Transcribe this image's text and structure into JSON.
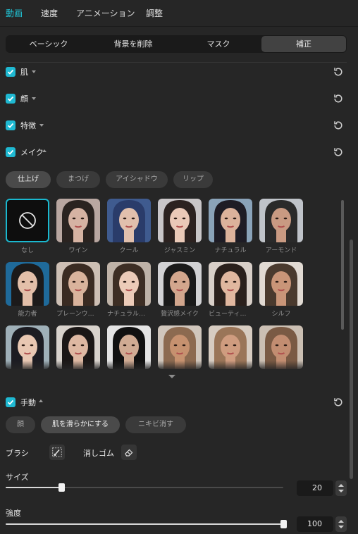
{
  "nav": {
    "tabs": [
      {
        "label": "動画",
        "active": true
      },
      {
        "label": "速度",
        "active": false
      },
      {
        "label": "アニメーション",
        "active": false
      },
      {
        "label": "調整",
        "active": false
      }
    ]
  },
  "segment": {
    "options": [
      "ベーシック",
      "背景を削除",
      "マスク",
      "補正"
    ],
    "active": "補正"
  },
  "sections": {
    "skin": {
      "label": "肌",
      "checked": true,
      "expanded": false
    },
    "face": {
      "label": "顔",
      "checked": true,
      "expanded": false
    },
    "features": {
      "label": "特徴",
      "checked": true,
      "expanded": false
    },
    "makeup": {
      "label": "メイク",
      "checked": true,
      "expanded": true
    },
    "manual": {
      "label": "手動",
      "checked": true,
      "expanded": true
    }
  },
  "makeup_tabs": [
    "仕上げ",
    "まつげ",
    "アイシャドウ",
    "リップ"
  ],
  "makeup_active_tab": "仕上げ",
  "makeup_presets": [
    "なし",
    "ワイン",
    "クール",
    "ジャスミン",
    "ナチュラル",
    "アーモンド",
    "能力者",
    "プレーンウォ…",
    "ナチュラルメ…",
    "贅沢感メイク",
    "ビューティー…",
    "シルフ"
  ],
  "selected_preset": "なし",
  "manual_tabs": [
    "顔",
    "肌を滑らかにする",
    "ニキビ消す"
  ],
  "manual_active_tab": "肌を滑らかにする",
  "tools": {
    "brush_label": "ブラシ",
    "eraser_label": "消しゴム",
    "brush_icon": "brush-icon",
    "eraser_icon": "eraser-icon"
  },
  "size": {
    "label": "サイズ",
    "value": "20",
    "fraction": 0.2
  },
  "strength": {
    "label": "強度",
    "value": "100",
    "fraction": 1.0
  },
  "colors": {
    "accent": "#1fb9d2",
    "background": "#262626"
  }
}
